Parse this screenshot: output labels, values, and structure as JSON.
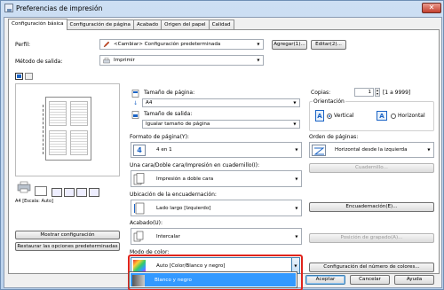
{
  "window": {
    "title": "Preferencias de impresión"
  },
  "tabs": [
    {
      "label": "Configuración básica"
    },
    {
      "label": "Configuración de página"
    },
    {
      "label": "Acabado"
    },
    {
      "label": "Origen del papel"
    },
    {
      "label": "Calidad"
    }
  ],
  "profile": {
    "label": "Perfil:",
    "value": "<Cambiar> Configuración predeterminada",
    "add_button": "Agregar(1)...",
    "edit_button": "Editar(2)..."
  },
  "output": {
    "label": "Método de salida:",
    "value": "Imprimir"
  },
  "page_size": {
    "label": "Tamaño de página:",
    "value": "A4"
  },
  "output_size": {
    "label": "Tamaño de salida:",
    "value": "Igualar tamaño de página"
  },
  "copies": {
    "label": "Copias:",
    "value": "1",
    "range": "[1 a 9999]"
  },
  "orientation": {
    "label": "Orientación",
    "options": [
      {
        "label": "Vertical",
        "checked": true
      },
      {
        "label": "Horizontal",
        "checked": false
      }
    ]
  },
  "layout": {
    "label": "Formato de página(Y):",
    "value": "4 en 1",
    "badge": "4"
  },
  "page_order": {
    "label": "Orden de páginas:",
    "value": "Horizontal desde la izquierda"
  },
  "booklet_button": "Cuadernillo...",
  "duplex": {
    "label": "Una cara/Doble cara/Impresión en cuadernillo(I):",
    "value": "Impresión a doble cara"
  },
  "binding_location": {
    "label": "Ubicación de la encuadernación:",
    "value": "Lado largo [Izquierdo]"
  },
  "binding_button": "Encuadernación(E)...",
  "finishing": {
    "label": "Acabado(U):",
    "value": "Intercalar"
  },
  "staple_button": "Posición de grapado(A)...",
  "color_mode": {
    "label": "Modo de color:",
    "value": "Auto [Color/Blanco y negro]",
    "dropdown_option": "Blanco y negro"
  },
  "color_config_button": "Configuración del número de colores...",
  "preview": {
    "caption": "A4 [Escala: Auto]"
  },
  "show_settings_button": "Mostrar configuración",
  "restore_defaults_button": "Restaurar las opciones predeterminadas",
  "dialog_buttons": {
    "ok": "Aceptar",
    "cancel": "Cancelar",
    "help": "Ayuda"
  },
  "colors": {
    "selection": "#3399ff",
    "highlight": "#e0231b",
    "accent": "#1b64c6"
  }
}
